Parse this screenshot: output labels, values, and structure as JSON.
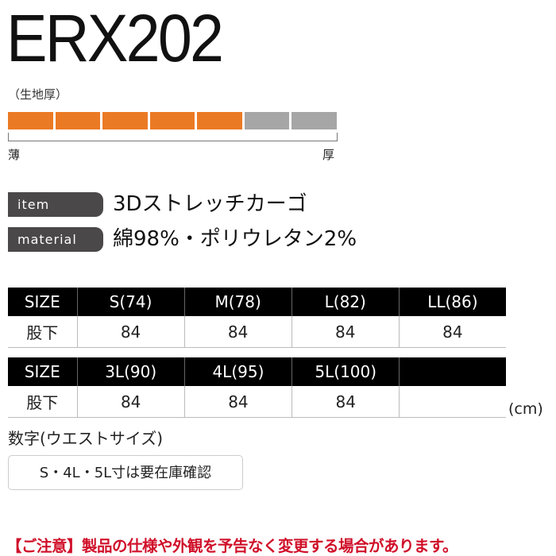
{
  "product": {
    "code": "ERX202"
  },
  "fabric_thickness": {
    "label": "（生地厚）",
    "level": 5,
    "max_level": 7,
    "thin_label": "薄",
    "thick_label": "厚",
    "colors": {
      "filled": "#eb7a24",
      "empty": "#a6a6a6"
    }
  },
  "specs": [
    {
      "tag": "item",
      "value": "3Dストレッチカーゴ"
    },
    {
      "tag": "material",
      "value": "綿98%・ポリウレタン2%"
    }
  ],
  "size_tables": [
    {
      "header_label": "SIZE",
      "sizes": [
        "S(74)",
        "M(78)",
        "L(82)",
        "LL(86)"
      ],
      "row_label": "股下",
      "values": [
        "84",
        "84",
        "84",
        "84"
      ]
    },
    {
      "header_label": "SIZE",
      "sizes": [
        "3L(90)",
        "4L(95)",
        "5L(100)",
        ""
      ],
      "row_label": "股下",
      "values": [
        "84",
        "84",
        "84",
        ""
      ]
    }
  ],
  "unit": "(cm)",
  "note": "数字(ウエストサイズ)",
  "stock_notice": "S・4L・5L寸は要在庫確認",
  "caution": "【ご注意】製品の仕様や外観を予告なく変更する場合があります。"
}
